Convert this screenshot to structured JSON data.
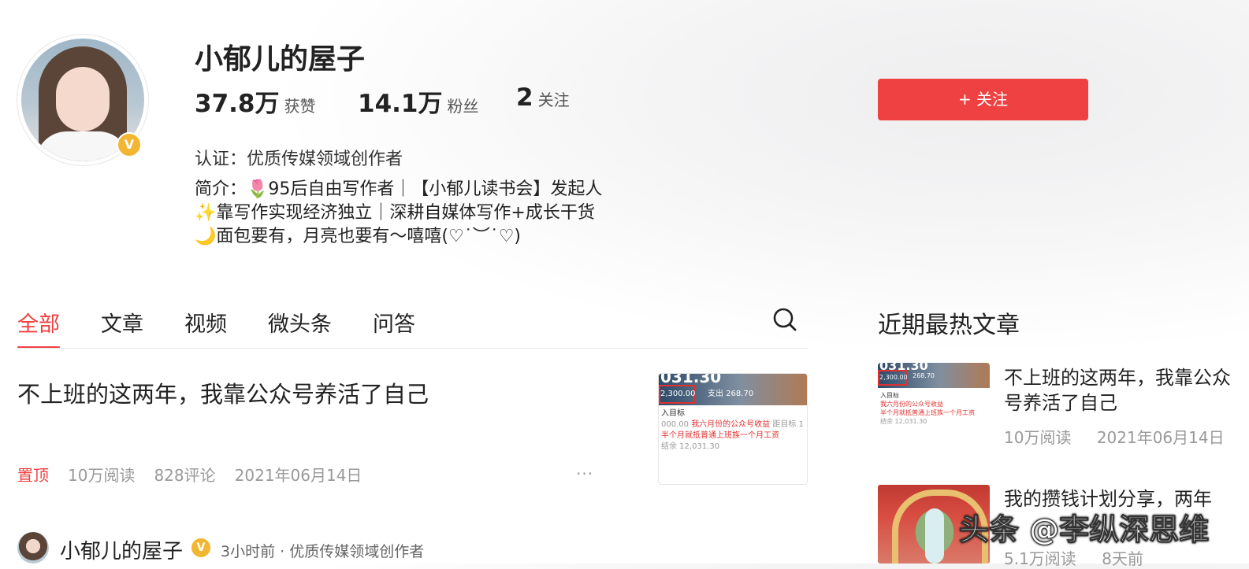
{
  "profile": {
    "name": "小郁儿的屋子",
    "avatar_badge": "V",
    "stats": [
      {
        "num": "37.8万",
        "label": "获赞"
      },
      {
        "num": "14.1万",
        "label": "粉丝"
      },
      {
        "num": "2",
        "label": "关注"
      }
    ],
    "follow_label": "+ 关注",
    "certification": "认证：优质传媒领域创作者",
    "bio_lines": [
      "简介：🌷95后自由写作者｜【小郁儿读书会】发起人",
      "✨靠写作实现经济独立｜深耕自媒体写作+成长干货",
      "🌙面包要有，月亮也要有～嘻嘻(♡˙︶˙♡)"
    ]
  },
  "tabs": [
    "全部",
    "文章",
    "视频",
    "微头条",
    "问答"
  ],
  "active_tab": "全部",
  "search_icon": "search-icon",
  "feed": {
    "article": {
      "title": "不上班的这两年，我靠公众号养活了自己",
      "pinned": "置顶",
      "reads": "10万阅读",
      "comments": "828评论",
      "date": "2021年06月14日",
      "more": "···",
      "thumb": {
        "big_num": "031.30",
        "boxed": "2,300.00",
        "expense_label": "支出",
        "expense": "268.70",
        "target": "入目标",
        "row_num": "000.00",
        "line1": "我六月份的公众号收益",
        "line2": "半个月就抵普通上班族一个月工资",
        "side": "距目标 1",
        "balance": "结余 12,031.30"
      }
    },
    "author_line": {
      "name": "小郁儿的屋子",
      "badge": "V",
      "meta": "3小时前 · 优质传媒领域创作者"
    }
  },
  "sidebar": {
    "title": "近期最热文章",
    "items": [
      {
        "title": "不上班的这两年，我靠公众号养活了自己",
        "reads": "10万阅读",
        "date": "2021年06月14日"
      },
      {
        "title": "我的攒钱计划分享，两年",
        "reads": "5.1万阅读",
        "date": "8天前"
      }
    ]
  },
  "watermark": "头条 @李纵深思维",
  "colors": {
    "accent": "#f04142",
    "badge": "#f2b632"
  }
}
